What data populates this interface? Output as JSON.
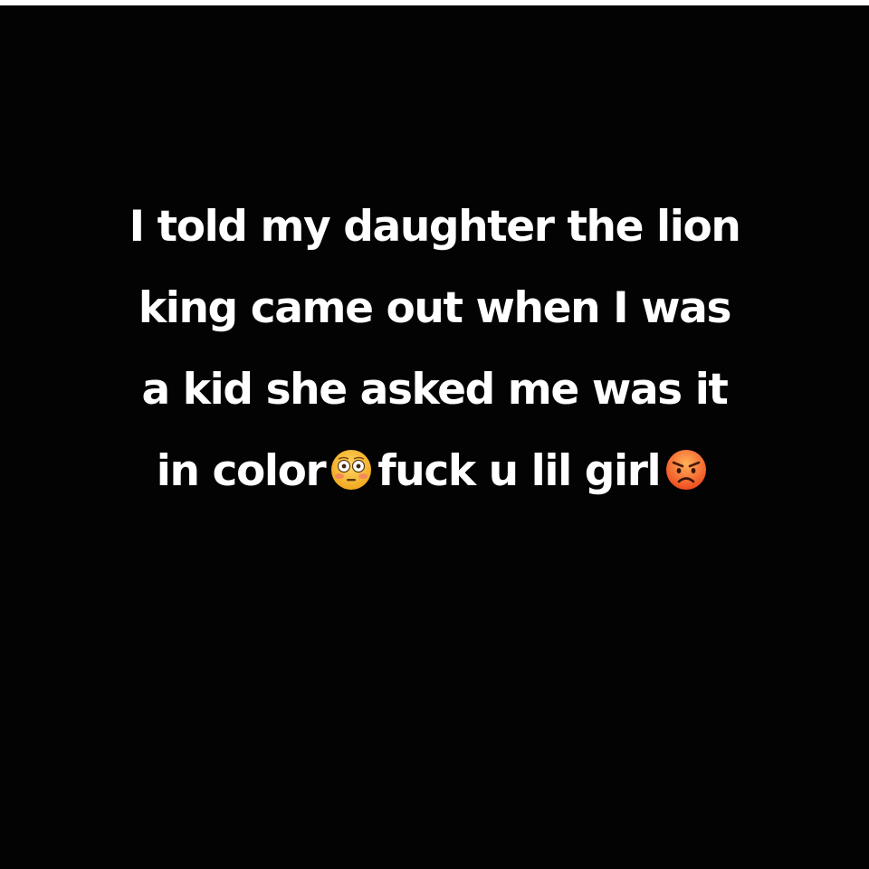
{
  "post": {
    "lines": [
      "I told my daughter the lion",
      "king came out when I was",
      "a kid she asked me was it"
    ],
    "last_line": {
      "part1": "in color",
      "part2": "fuck u lil girl"
    },
    "emojis": [
      "flushed-face-icon",
      "angry-face-icon"
    ]
  },
  "colors": {
    "background": "#030303",
    "text": "#ffffff",
    "top_strip": "#ffffff",
    "emoji_face": "#f7b72e",
    "angry_face": "#f15a24"
  }
}
